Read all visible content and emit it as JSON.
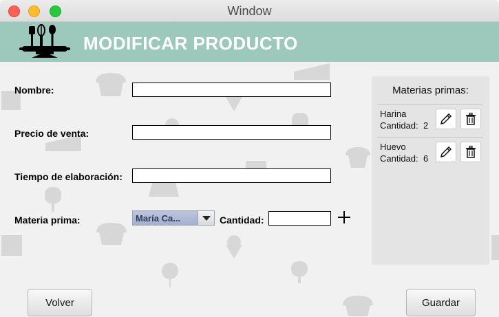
{
  "window": {
    "title": "Window"
  },
  "header": {
    "title": "MODIFICAR PRODUCTO",
    "background": "#9dc9bd"
  },
  "form": {
    "nombre_label": "Nombre:",
    "nombre_value": "",
    "precio_label": "Precio de venta:",
    "precio_value": "",
    "tiempo_label": "Tiempo de elaboración:",
    "tiempo_value": "",
    "materia_label": "Materia prima:",
    "materia_selected": "María Ca...",
    "cantidad_label": "Cantidad:",
    "cantidad_value": "",
    "add_icon": "plus-icon"
  },
  "panel": {
    "title": "Materias primas:",
    "items": [
      {
        "name": "Harina",
        "qty_label": "Cantidad:",
        "qty": "2"
      },
      {
        "name": "Huevo",
        "qty_label": "Cantidad:",
        "qty": "6"
      }
    ],
    "edit_icon": "pencil-icon",
    "delete_icon": "trash-icon"
  },
  "buttons": {
    "back": "Volver",
    "save": "Guardar"
  }
}
